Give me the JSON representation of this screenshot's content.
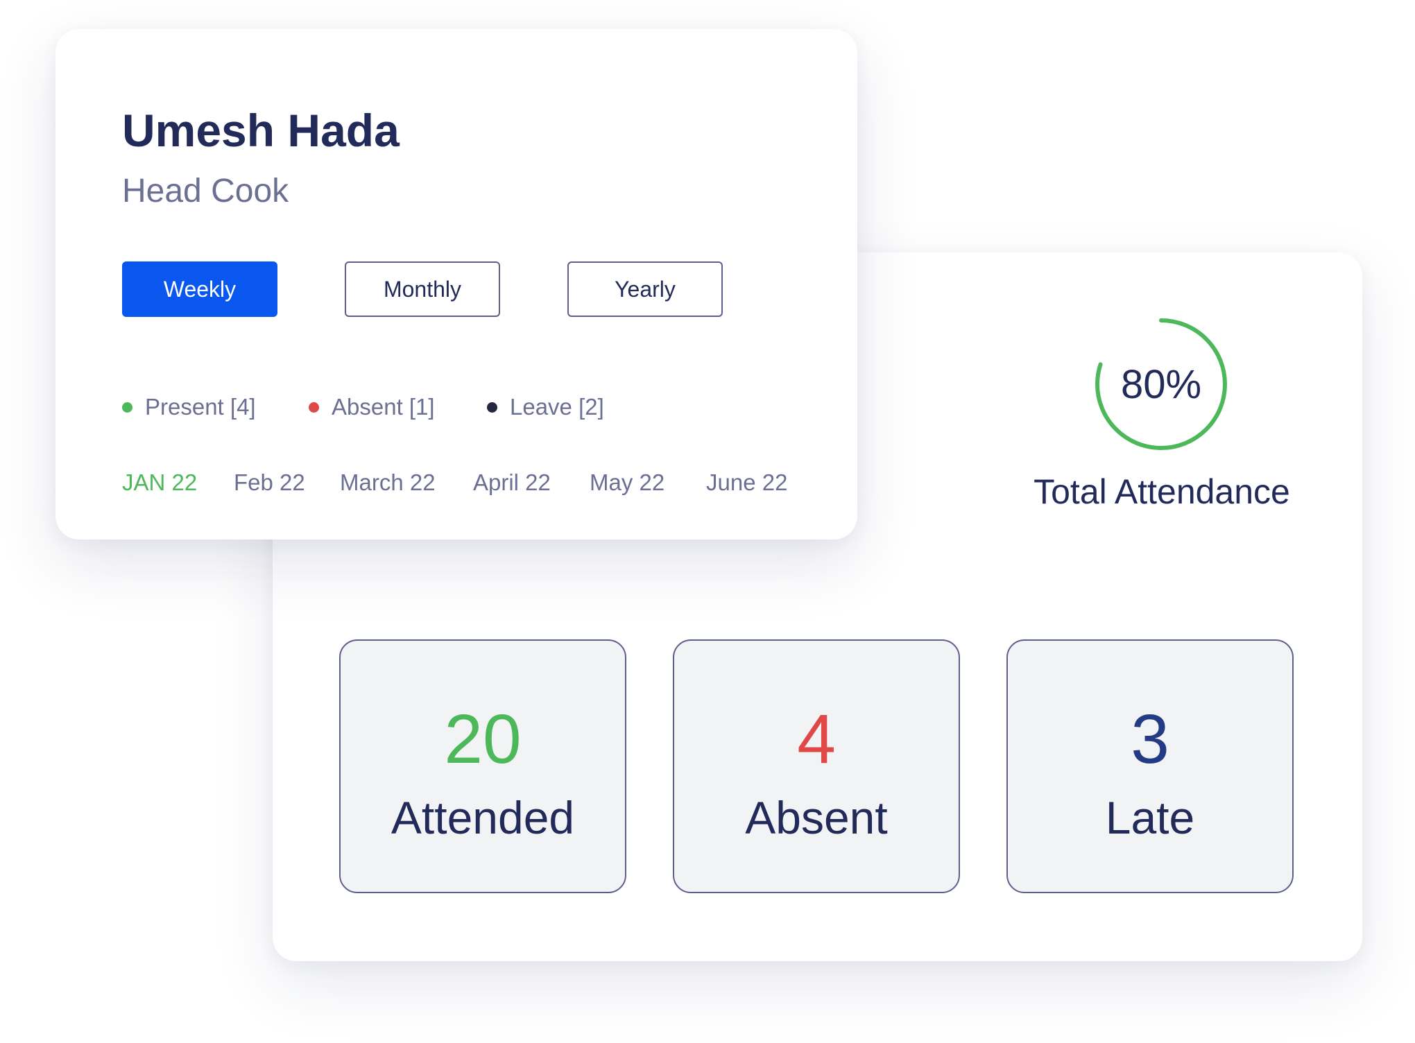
{
  "profile": {
    "name": "Umesh Hada",
    "role": "Head Cook",
    "periods": [
      {
        "label": "Weekly",
        "selected": true
      },
      {
        "label": "Monthly",
        "selected": false
      },
      {
        "label": "Yearly",
        "selected": false
      }
    ],
    "legend": [
      {
        "label": "Present [4]",
        "color": "#4db85a"
      },
      {
        "label": "Absent [1]",
        "color": "#e04848"
      },
      {
        "label": "Leave [2]",
        "color": "#232740"
      }
    ],
    "months": [
      {
        "label": "JAN 22",
        "active": true
      },
      {
        "label": "Feb 22",
        "active": false
      },
      {
        "label": "March 22",
        "active": false
      },
      {
        "label": "April 22",
        "active": false
      },
      {
        "label": "May 22",
        "active": false
      },
      {
        "label": "June 22",
        "active": false
      }
    ]
  },
  "attendance": {
    "percent_text": "80%",
    "progress": 0.8,
    "ring_color": "#4db85a",
    "caption": "Total Attendance"
  },
  "stats": [
    {
      "value": "20",
      "label": "Attended",
      "color": "#4db85a"
    },
    {
      "value": "4",
      "label": "Absent",
      "color": "#e04848"
    },
    {
      "value": "3",
      "label": "Late",
      "color": "#233a84"
    }
  ],
  "colors": {
    "accent_blue": "#0a57f0",
    "text_dark": "#222a5a",
    "text_muted": "#6b6f92"
  }
}
